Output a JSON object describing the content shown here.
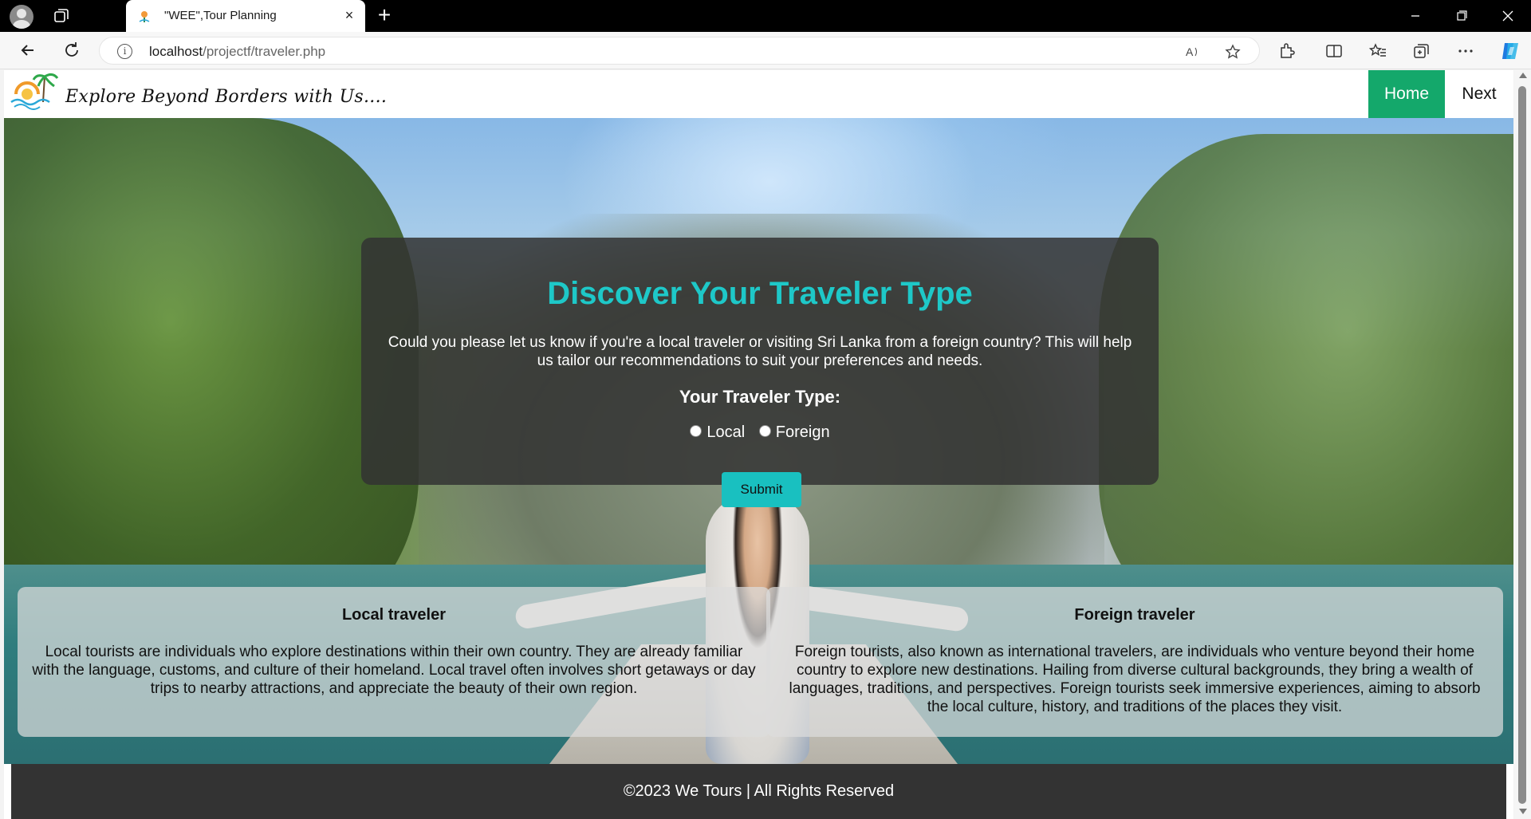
{
  "browser": {
    "tab_title": "\"WEE\",Tour Planning",
    "new_tab_symbol": "+",
    "url_host": "localhost",
    "url_path": "/projectf/traveler.php",
    "tab_close_symbol": "×"
  },
  "site": {
    "tagline": "Explore Beyond Borders with Us....",
    "nav": {
      "home": "Home",
      "next": "Next"
    },
    "active_nav_color": "#14a86b"
  },
  "form": {
    "title": "Discover Your Traveler Type",
    "description": "Could you please let us know if you're a local traveler or visiting Sri Lanka from a foreign country? This will help us tailor our recommendations to suit your preferences and needs.",
    "label": "Your Traveler Type:",
    "options": [
      {
        "label": "Local",
        "selected": false
      },
      {
        "label": "Foreign",
        "selected": false
      }
    ],
    "submit_label": "Submit",
    "accent_color": "#1ec8c8"
  },
  "info": {
    "local": {
      "title": "Local traveler",
      "body": "Local tourists are individuals who explore destinations within their own country. They are already familiar with the language, customs, and culture of their homeland. Local travel often involves short getaways or day trips to nearby attractions, and appreciate the beauty of their own region."
    },
    "foreign": {
      "title": "Foreign traveler",
      "body": "Foreign tourists, also known as international travelers, are individuals who venture beyond their home country to explore new destinations. Hailing from diverse cultural backgrounds, they bring a wealth of languages, traditions, and perspectives. Foreign tourists seek immersive experiences, aiming to absorb the local culture, history, and traditions of the places they visit."
    }
  },
  "footer": {
    "text": "©2023 We Tours | All Rights Reserved"
  },
  "icons": [
    "profile-icon",
    "workspaces-icon",
    "back-icon",
    "refresh-icon",
    "info-icon",
    "read-aloud-icon",
    "favorite-star-icon",
    "extensions-icon",
    "split-screen-icon",
    "favorites-icon",
    "collections-icon",
    "more-icon",
    "copilot-icon",
    "minimize-icon",
    "restore-icon",
    "close-icon"
  ]
}
